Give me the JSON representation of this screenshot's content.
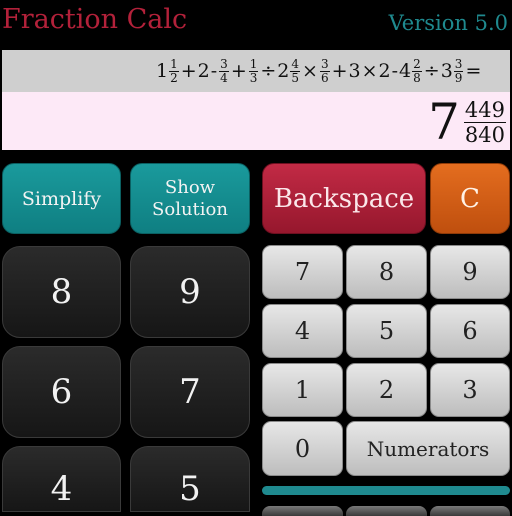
{
  "header": {
    "title": "Fraction Calc",
    "version": "Version 5.0"
  },
  "display": {
    "expression": [
      {
        "t": "num",
        "v": "1"
      },
      {
        "t": "fr",
        "n": "1",
        "d": "2"
      },
      {
        "t": "op",
        "v": "+"
      },
      {
        "t": "num",
        "v": "2"
      },
      {
        "t": "op",
        "v": "-"
      },
      {
        "t": "fr",
        "n": "3",
        "d": "4"
      },
      {
        "t": "op",
        "v": "+"
      },
      {
        "t": "fr",
        "n": "1",
        "d": "3"
      },
      {
        "t": "op",
        "v": "÷"
      },
      {
        "t": "num",
        "v": "2"
      },
      {
        "t": "fr",
        "n": "4",
        "d": "5"
      },
      {
        "t": "op",
        "v": "×"
      },
      {
        "t": "fr",
        "n": "3",
        "d": "6"
      },
      {
        "t": "op",
        "v": "+"
      },
      {
        "t": "num",
        "v": "3"
      },
      {
        "t": "op",
        "v": "×"
      },
      {
        "t": "num",
        "v": "2"
      },
      {
        "t": "op",
        "v": "-"
      },
      {
        "t": "num",
        "v": "4"
      },
      {
        "t": "fr",
        "n": "2",
        "d": "8"
      },
      {
        "t": "op",
        "v": "÷"
      },
      {
        "t": "num",
        "v": "3"
      },
      {
        "t": "fr",
        "n": "3",
        "d": "9"
      },
      {
        "t": "op",
        "v": "="
      }
    ],
    "result": {
      "whole": "7",
      "numerator": "449",
      "denominator": "840"
    }
  },
  "actions": {
    "simplify": "Simplify",
    "show_solution_line1": "Show",
    "show_solution_line2": "Solution",
    "backspace": "Backspace",
    "clear": "C"
  },
  "left_pad": {
    "keys": [
      "8",
      "9",
      "6",
      "7",
      "4",
      "5"
    ]
  },
  "right_pad": {
    "keys": [
      "7",
      "8",
      "9",
      "4",
      "5",
      "6",
      "1",
      "2",
      "3",
      "0"
    ],
    "numerators": "Numerators"
  }
}
